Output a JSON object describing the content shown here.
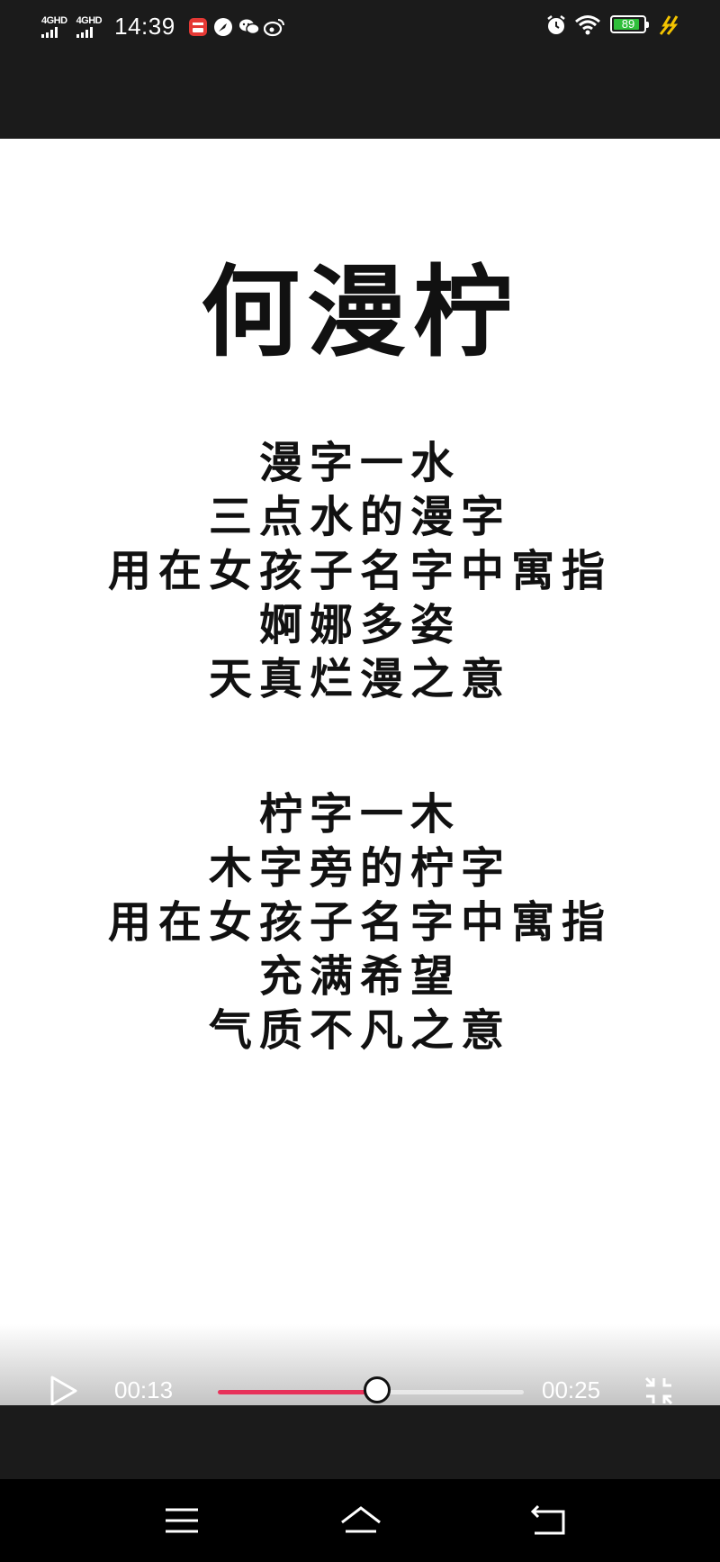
{
  "status_bar": {
    "signal_1_label": "4GHD",
    "signal_2_label": "4GHD",
    "time": "14:39",
    "battery_level": 89,
    "battery_text": "89",
    "icons": [
      "signal-icon",
      "signal-icon",
      "app-notification-icon",
      "compass-app-icon",
      "wechat-icon",
      "weibo-icon",
      "alarm-icon",
      "wifi-icon",
      "battery-icon",
      "charging-icon"
    ]
  },
  "video": {
    "title": "何漫柠",
    "stanza_1": [
      "漫字一水",
      "三点水的漫字",
      "用在女孩子名字中寓指",
      "婀娜多姿",
      "天真烂漫之意"
    ],
    "stanza_2": [
      "柠字一木",
      "木字旁的柠字",
      "用在女孩子名字中寓指",
      "充满希望",
      "气质不凡之意"
    ]
  },
  "player": {
    "current_time": "00:13",
    "total_time": "00:25",
    "progress": 0.52,
    "accent_color": "#e8325a",
    "icons": [
      "play-icon",
      "exit-fullscreen-icon"
    ]
  },
  "nav_bar": {
    "icons": [
      "menu-icon",
      "home-icon",
      "back-icon"
    ]
  }
}
